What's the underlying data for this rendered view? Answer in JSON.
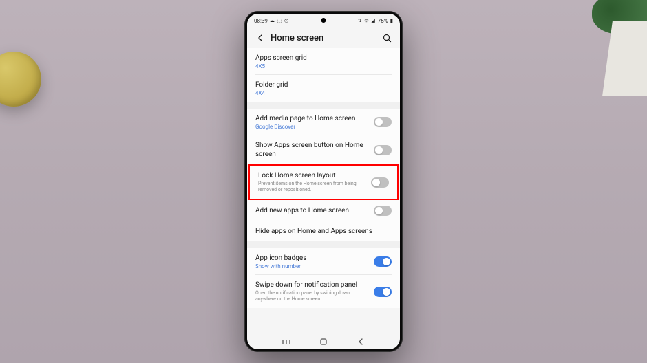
{
  "status_bar": {
    "time": "08:39",
    "battery": "75%"
  },
  "header": {
    "title": "Home screen"
  },
  "settings": {
    "apps_grid": {
      "title": "Apps screen grid",
      "value": "4X5"
    },
    "folder_grid": {
      "title": "Folder grid",
      "value": "4X4"
    },
    "media_page": {
      "title": "Add media page to Home screen",
      "sub": "Google Discover"
    },
    "show_apps_btn": {
      "title": "Show Apps screen button on Home screen"
    },
    "lock_layout": {
      "title": "Lock Home screen layout",
      "desc": "Prevent items on the Home screen from being removed or repositioned."
    },
    "add_new_apps": {
      "title": "Add new apps to Home screen"
    },
    "hide_apps": {
      "title": "Hide apps on Home and Apps screens"
    },
    "icon_badges": {
      "title": "App icon badges",
      "sub": "Show with number"
    },
    "swipe_down": {
      "title": "Swipe down for notification panel",
      "desc": "Open the notification panel by swiping down anywhere on the Home screen."
    }
  }
}
